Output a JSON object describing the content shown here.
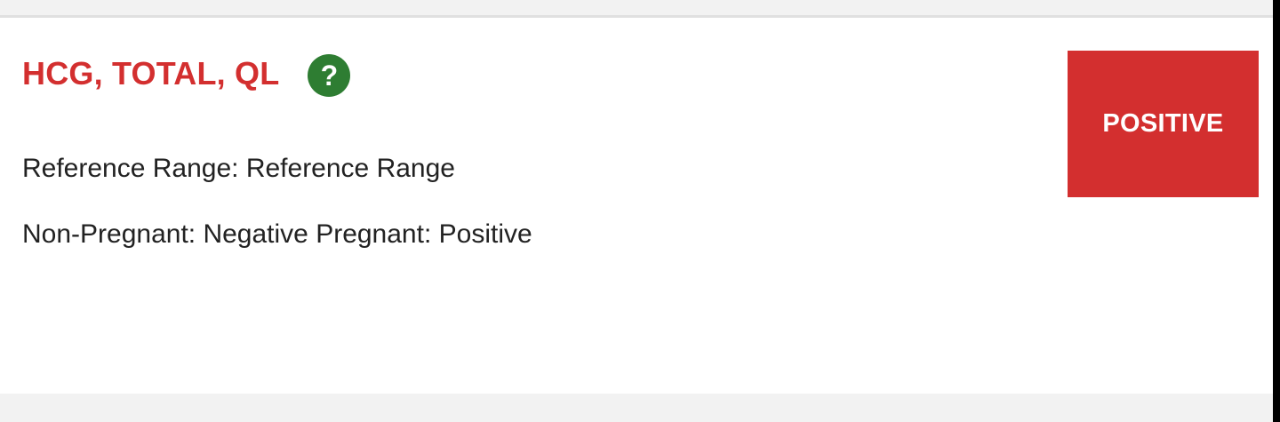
{
  "test": {
    "title": "HCG, TOTAL, QL",
    "help_icon": "question-mark-icon",
    "help_glyph": "?",
    "reference_range_line": "Reference Range: Reference Range",
    "interpretation_line": "Non-Pregnant: Negative Pregnant: Positive"
  },
  "result": {
    "value": "POSITIVE",
    "status_color": "#d32f2f"
  },
  "colors": {
    "title": "#d32f2f",
    "help_icon_bg": "#2e7d32"
  }
}
